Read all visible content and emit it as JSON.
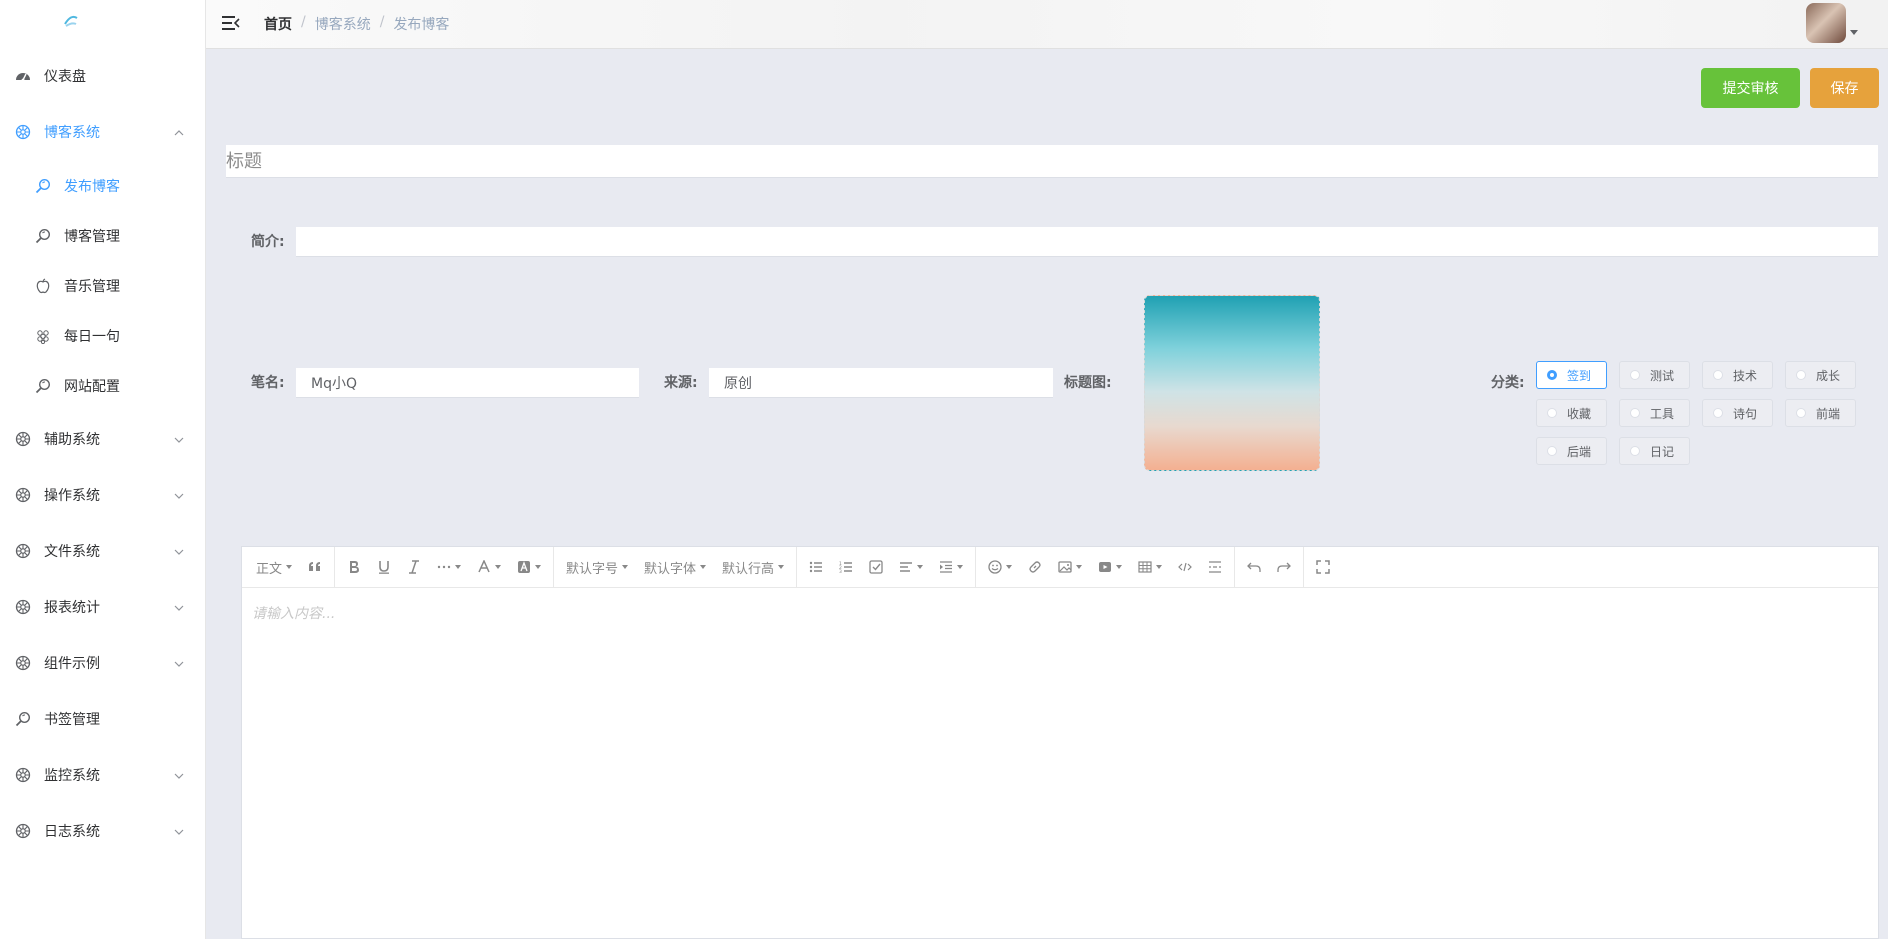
{
  "sidebar": {
    "items": [
      {
        "label": "仪表盘",
        "icon": "dashboard-icon",
        "type": "top"
      },
      {
        "label": "博客系统",
        "icon": "system-icon",
        "type": "group",
        "expanded": true,
        "active": true
      },
      {
        "label": "发布博客",
        "icon": "magnifier-icon",
        "type": "sub",
        "active": true
      },
      {
        "label": "博客管理",
        "icon": "magnifier-icon",
        "type": "sub"
      },
      {
        "label": "音乐管理",
        "icon": "apple-icon",
        "type": "sub"
      },
      {
        "label": "每日一句",
        "icon": "grape-icon",
        "type": "sub"
      },
      {
        "label": "网站配置",
        "icon": "magnifier-icon",
        "type": "sub"
      },
      {
        "label": "辅助系统",
        "icon": "system-icon",
        "type": "group"
      },
      {
        "label": "操作系统",
        "icon": "system-icon",
        "type": "group"
      },
      {
        "label": "文件系统",
        "icon": "system-icon",
        "type": "group"
      },
      {
        "label": "报表统计",
        "icon": "system-icon",
        "type": "group"
      },
      {
        "label": "组件示例",
        "icon": "system-icon",
        "type": "group"
      },
      {
        "label": "书签管理",
        "icon": "magnifier-icon",
        "type": "top"
      },
      {
        "label": "监控系统",
        "icon": "system-icon",
        "type": "group"
      },
      {
        "label": "日志系统",
        "icon": "system-icon",
        "type": "group"
      }
    ]
  },
  "header": {
    "breadcrumb": [
      "首页",
      "博客系统",
      "发布博客"
    ],
    "separator": "/"
  },
  "actions": {
    "submit_label": "提交审核",
    "save_label": "保存"
  },
  "form": {
    "title_placeholder": "标题",
    "title_value": "",
    "summary_label": "简介:",
    "summary_value": "",
    "author_label": "笔名:",
    "author_value": "Mq小Q",
    "source_label": "来源:",
    "source_value": "原创",
    "cover_label": "标题图:",
    "category_label": "分类:",
    "categories": [
      "签到",
      "测试",
      "技术",
      "成长",
      "收藏",
      "工具",
      "诗句",
      "前端",
      "后端",
      "日记"
    ],
    "selected_category": "签到"
  },
  "editor": {
    "placeholder": "请输入内容...",
    "toolbar": {
      "paragraph": "正文",
      "font_size": "默认字号",
      "font_family": "默认字体",
      "line_height": "默认行高"
    }
  },
  "colors": {
    "primary": "#409eff",
    "submit": "#67c23a",
    "save": "#e6a23c",
    "background": "#e8eaf1"
  }
}
